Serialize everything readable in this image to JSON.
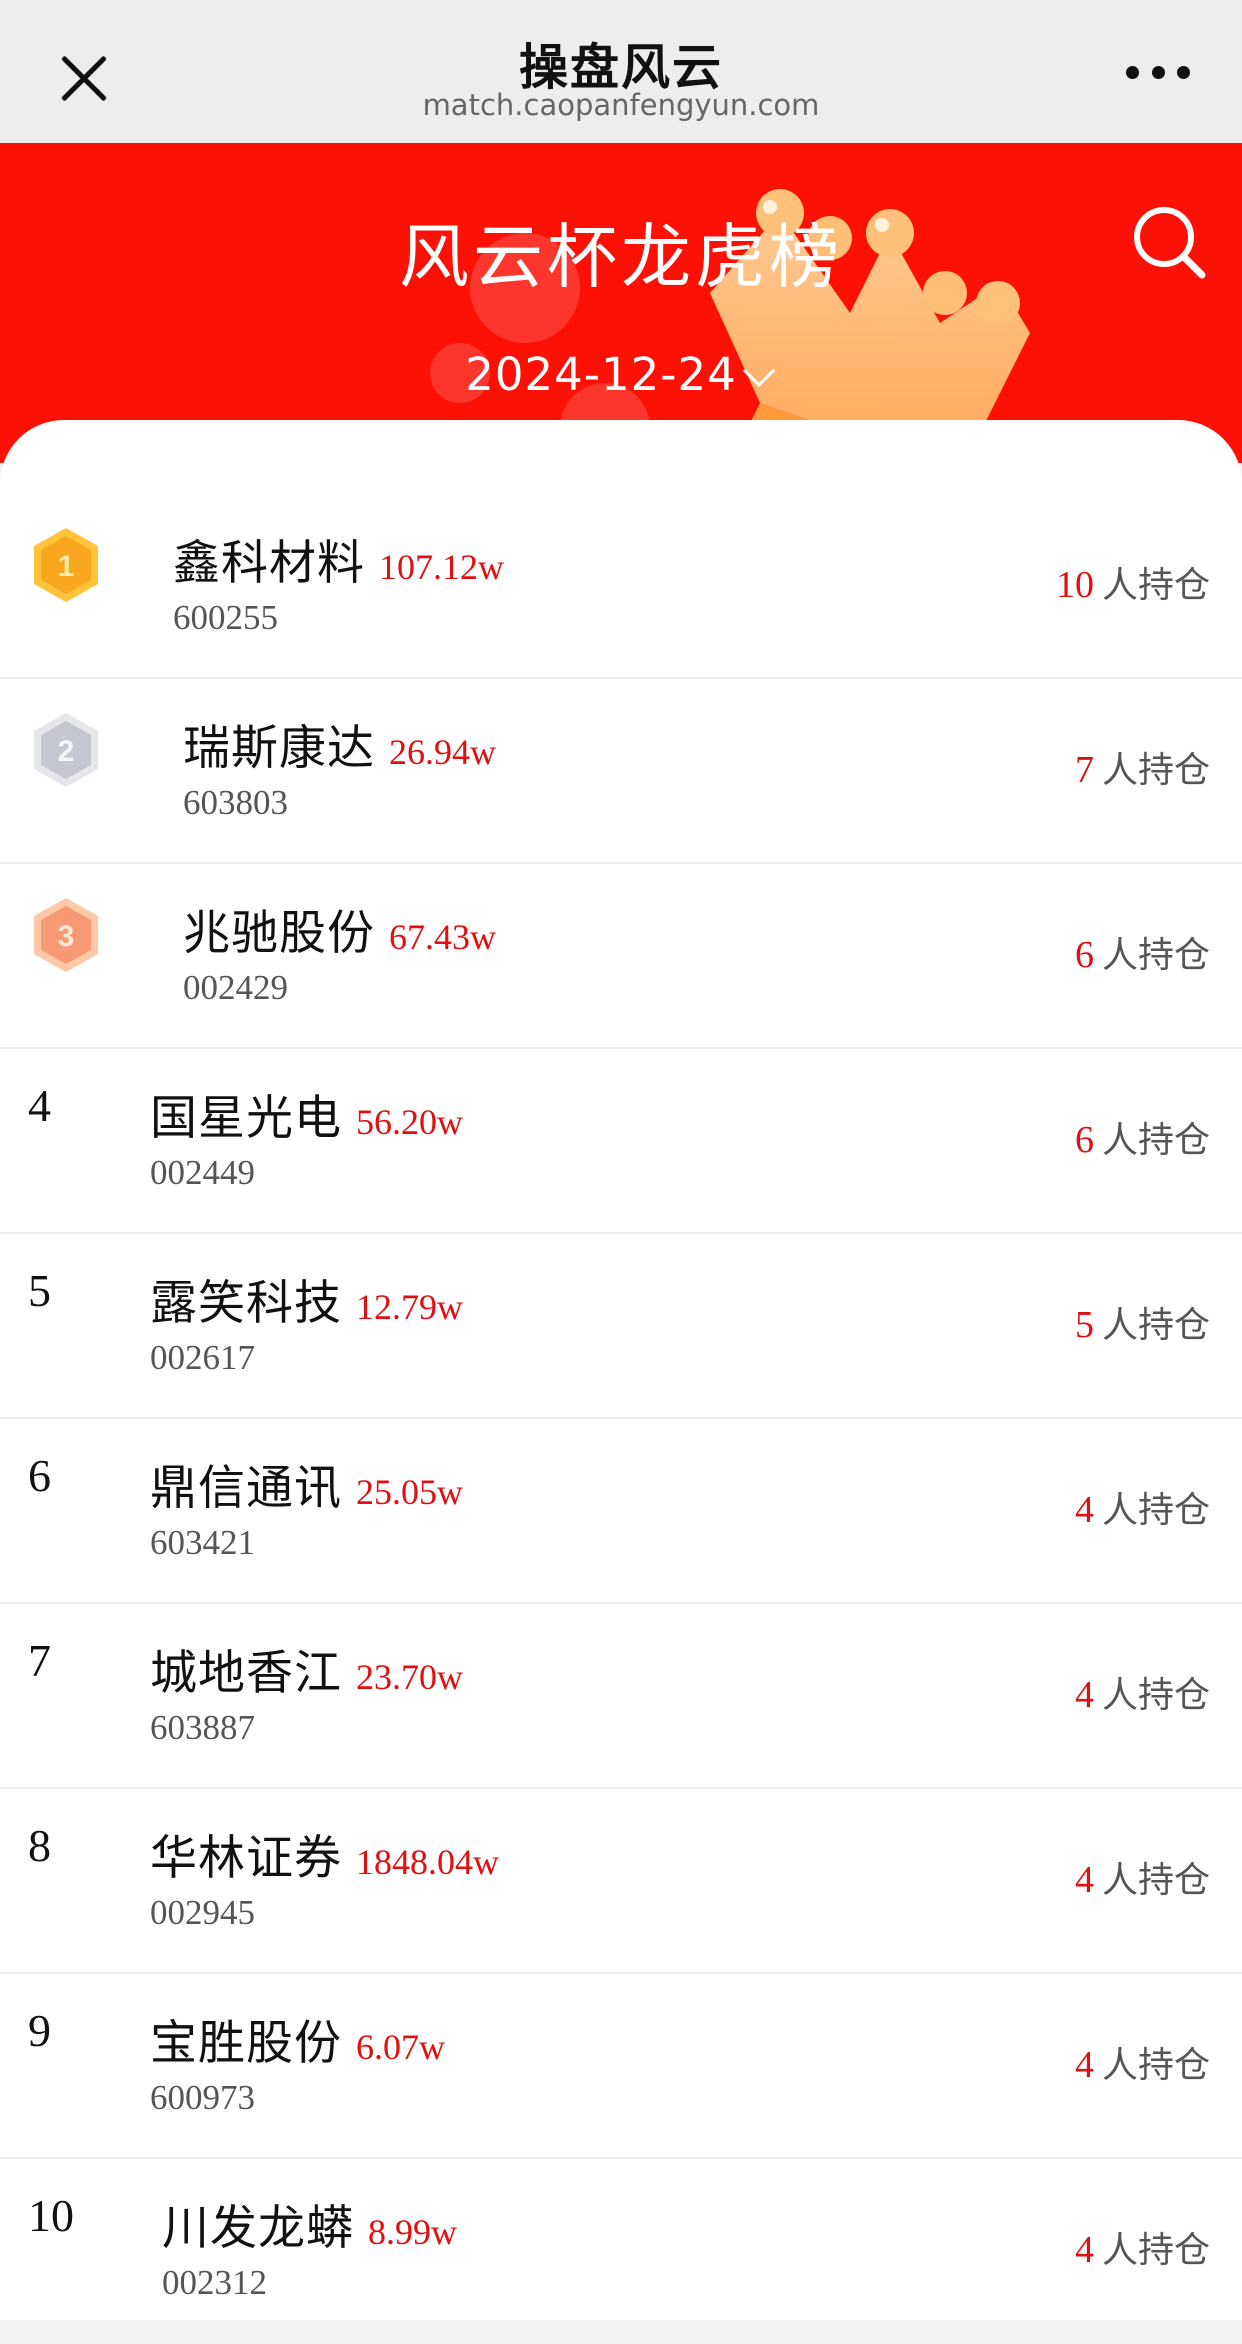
{
  "browser_bar": {
    "title": "操盘风云",
    "url": "match.caopanfengyun.com"
  },
  "header": {
    "title": "风云杯龙虎榜",
    "date": "2024-12-24"
  },
  "holders_suffix": "人持仓",
  "colors": {
    "header_red": "#fd1005",
    "amount_red": "#e01010",
    "gold": "#f7b733",
    "silver": "#c9ccd3",
    "bronze": "#f3a27e"
  },
  "rows": [
    {
      "rank": "1",
      "name": "鑫科材料",
      "amount": "107.12w",
      "code": "600255",
      "holders": "10"
    },
    {
      "rank": "2",
      "name": "瑞斯康达",
      "amount": "26.94w",
      "code": "603803",
      "holders": "7"
    },
    {
      "rank": "3",
      "name": "兆驰股份",
      "amount": "67.43w",
      "code": "002429",
      "holders": "6"
    },
    {
      "rank": "4",
      "name": "国星光电",
      "amount": "56.20w",
      "code": "002449",
      "holders": "6"
    },
    {
      "rank": "5",
      "name": "露笑科技",
      "amount": "12.79w",
      "code": "002617",
      "holders": "5"
    },
    {
      "rank": "6",
      "name": "鼎信通讯",
      "amount": "25.05w",
      "code": "603421",
      "holders": "4"
    },
    {
      "rank": "7",
      "name": "城地香江",
      "amount": "23.70w",
      "code": "603887",
      "holders": "4"
    },
    {
      "rank": "8",
      "name": "华林证券",
      "amount": "1848.04w",
      "code": "002945",
      "holders": "4"
    },
    {
      "rank": "9",
      "name": "宝胜股份",
      "amount": "6.07w",
      "code": "600973",
      "holders": "4"
    },
    {
      "rank": "10",
      "name": "川发龙蟒",
      "amount": "8.99w",
      "code": "002312",
      "holders": "4"
    }
  ]
}
